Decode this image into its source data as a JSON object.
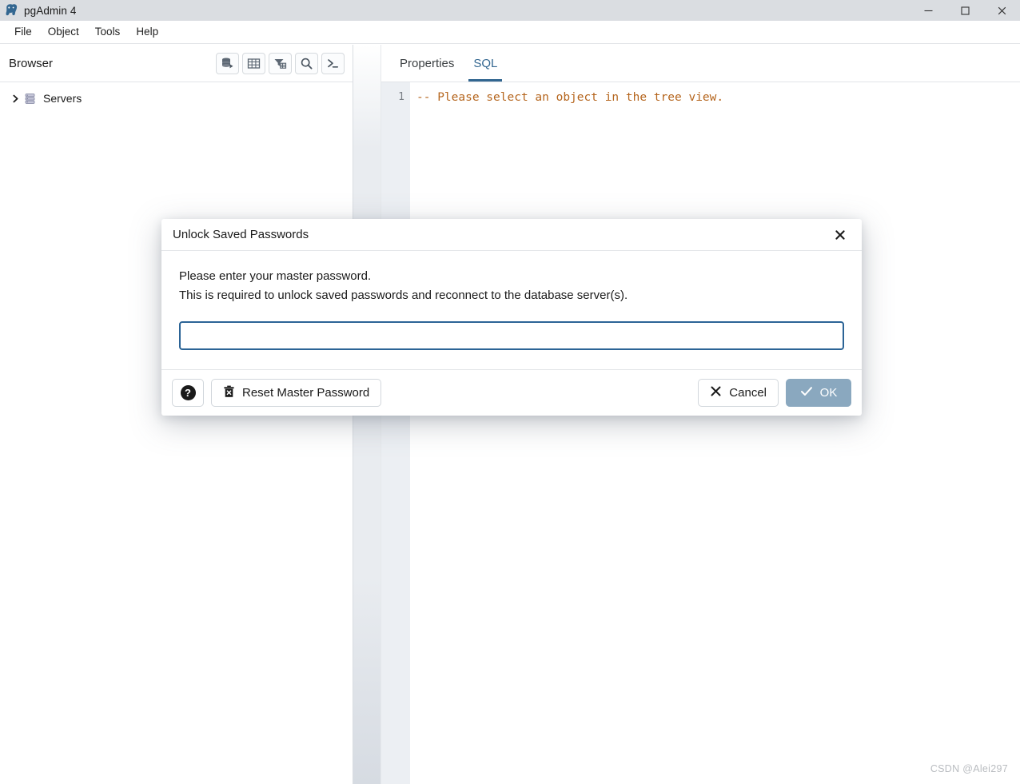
{
  "window": {
    "title": "pgAdmin 4",
    "logo_icon": "pgadmin-elephant-icon",
    "controls": {
      "minimize": "minimize-icon",
      "maximize": "maximize-icon",
      "close": "close-icon"
    }
  },
  "menubar": {
    "items": [
      {
        "label": "File"
      },
      {
        "label": "Object"
      },
      {
        "label": "Tools"
      },
      {
        "label": "Help"
      }
    ]
  },
  "browser": {
    "title": "Browser",
    "tools": [
      {
        "name": "query-tool-icon",
        "tooltip": "Query Tool"
      },
      {
        "name": "view-data-icon",
        "tooltip": "View Data"
      },
      {
        "name": "filtered-rows-icon",
        "tooltip": "Filtered Rows"
      },
      {
        "name": "search-icon",
        "tooltip": "Search Objects"
      },
      {
        "name": "psql-terminal-icon",
        "tooltip": "PSQL Tool"
      }
    ],
    "tree": [
      {
        "label": "Servers",
        "icon": "servers-icon",
        "expanded": false,
        "chevron": "chevron-right-icon"
      }
    ]
  },
  "right_panel": {
    "tabs": [
      {
        "label": "Properties",
        "active": false
      },
      {
        "label": "SQL",
        "active": true
      }
    ],
    "editor": {
      "line_number": "1",
      "content": "-- Please select an object in the tree view."
    }
  },
  "dialog": {
    "title": "Unlock Saved Passwords",
    "close_icon": "close-icon",
    "message_line1": "Please enter your master password.",
    "message_line2": "This is required to unlock saved passwords and reconnect to the database server(s).",
    "password_field": {
      "value": "",
      "placeholder": ""
    },
    "footer": {
      "help_label": "?",
      "help_icon": "help-icon",
      "reset_label": "Reset Master Password",
      "reset_icon": "trash-delete-icon",
      "cancel_label": "Cancel",
      "cancel_icon": "cross-icon",
      "ok_label": "OK",
      "ok_icon": "check-icon"
    }
  },
  "watermark": "CSDN @Alei297",
  "colors": {
    "accent": "#326690",
    "titlebar_bg": "#dadde1",
    "primary_button": "#8aa8bf",
    "input_focus_border": "#2c6496",
    "sql_comment": "#b5651d"
  }
}
